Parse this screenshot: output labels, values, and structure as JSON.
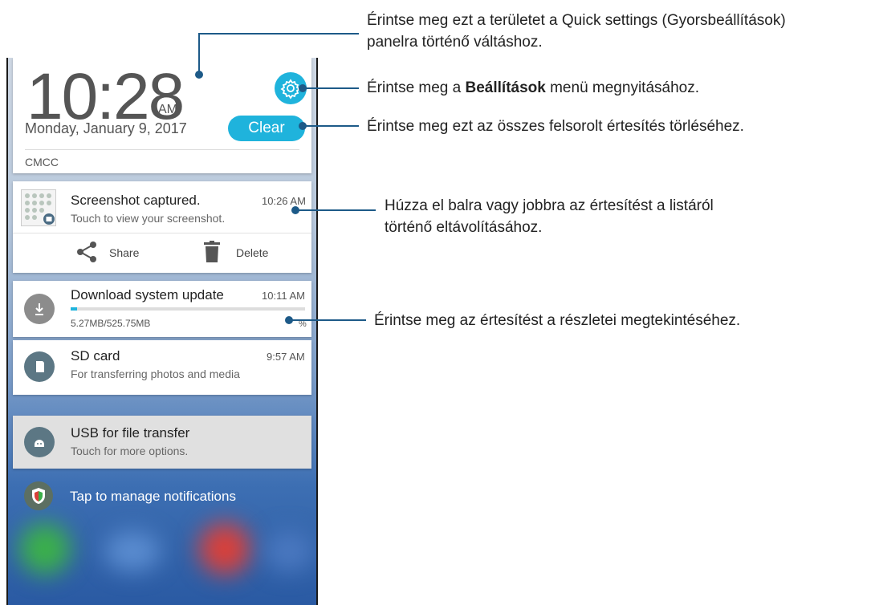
{
  "header": {
    "time": "10:28",
    "ampm": "AM",
    "date": "Monday, January 9, 2017",
    "clear_label": "Clear",
    "carrier": "CMCC"
  },
  "notifications": [
    {
      "title": "Screenshot captured.",
      "subtitle": "Touch to view your screenshot.",
      "time": "10:26 AM",
      "actions": [
        {
          "label": "Share",
          "icon": "share-icon"
        },
        {
          "label": "Delete",
          "icon": "trash-icon"
        }
      ]
    },
    {
      "title": "Download system update",
      "progress_text": "5.27MB/525.75MB",
      "progress_suffix": "%",
      "progress_fraction": 0.01,
      "time": "10:11 AM"
    },
    {
      "title": "SD card",
      "subtitle": "For transferring photos and media",
      "time": "9:57 AM"
    },
    {
      "title": "USB for file transfer",
      "subtitle": "Touch for more options."
    }
  ],
  "manage_label": "Tap to manage notifications",
  "callouts": {
    "quick_settings_line1": "Érintse meg ezt a területet a Quick settings (Gyorsbeállítások)",
    "quick_settings_line2": "panelra történő váltáshoz.",
    "settings_prefix": "Érintse meg a ",
    "settings_bold": "Beállítások",
    "settings_suffix": " menü megnyitásához.",
    "clear": "Érintse meg ezt az összes felsorolt értesítés törléséhez.",
    "swipe_line1": "Húzza el balra vagy jobbra az értesítést a listáról",
    "swipe_line2": "történő eltávolításához.",
    "details": "Érintse meg az értesítést a részletei megtekintéséhez."
  },
  "colors": {
    "accent": "#1fb3dc",
    "callout_line": "#1d5a88"
  }
}
